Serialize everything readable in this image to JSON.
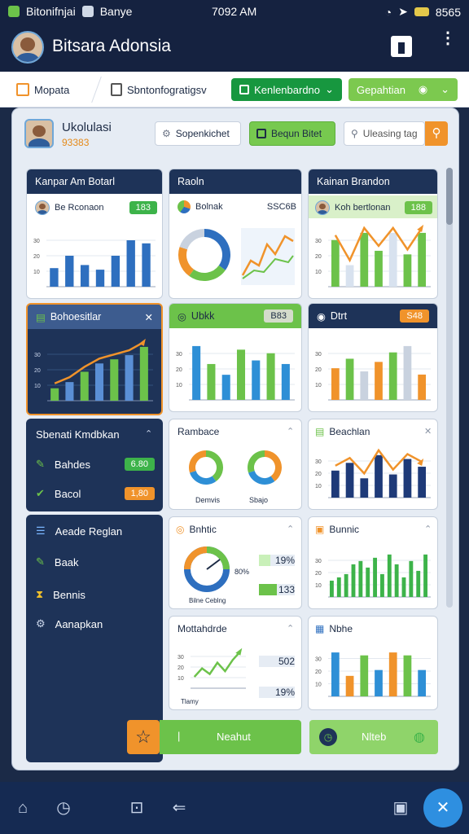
{
  "status": {
    "carrier": "Bitonifnjai",
    "app": "Banye",
    "time": "7092 AM",
    "battery": "8565"
  },
  "header": {
    "title": "Bitsara Adonsia"
  },
  "toolbar": {
    "left_label": "Mopata",
    "middle_label": "Sbntonfogratigsv",
    "green_button": "Kenlenbardno",
    "light_button": "Gepahtian"
  },
  "profile": {
    "name": "Ukolulasi",
    "code": "93383"
  },
  "actions": {
    "chip1": "Sopenkichet",
    "chip2": "Bequn Bitet",
    "search_placeholder": "Uleasing tag"
  },
  "cards": {
    "c1": {
      "title": "Kanpar Am Botarl",
      "sub": "Be Rconaon",
      "badge": "183"
    },
    "c2": {
      "title": "Raoln",
      "sub": "Bolnak",
      "badge": "SSC6B"
    },
    "c3": {
      "title": "Kainan Brandon",
      "sub": "Koh bertlonan",
      "badge": "188"
    },
    "c4": {
      "title": "Bohoesitlar"
    },
    "c5": {
      "title": "Ubkk",
      "badge": "B83"
    },
    "c6": {
      "title": "Dtrt",
      "badge": "S48"
    },
    "c7": {
      "title": "Rambace",
      "label1": "Demvis",
      "label2": "Sbajo"
    },
    "c8": {
      "title": "Beachlan"
    },
    "c9": {
      "title": "Bnhtic",
      "gauge_label": "Bilne Ceblng",
      "gauge_pct": "80%",
      "v1": "19%",
      "v2": "133"
    },
    "c10": {
      "title": "Bunnic"
    },
    "c11": {
      "title": "Mottahdrde",
      "foot": "Tlamy",
      "v1": "502",
      "v2": "19%"
    },
    "c12": {
      "title": "Nbhe"
    }
  },
  "summary": {
    "title": "Sbenati Kmdbkan",
    "row1": "Bahdes",
    "row1_val": "6.80",
    "row2": "Bacol",
    "row2_val": "1,80"
  },
  "nav": {
    "items": [
      "Aeade Reglan",
      "Baak",
      "Bennis",
      "Aanapkan"
    ]
  },
  "footer_buttons": {
    "b1": "Neahut",
    "b2": "Nlteb"
  },
  "colors": {
    "navy": "#1e3358",
    "green": "#6cc24a",
    "orange": "#f0932b",
    "blue": "#2e6fbf"
  },
  "chart_data": [
    {
      "type": "bar",
      "title": "Kanpar Am Botarl",
      "values": [
        12,
        20,
        14,
        11,
        20,
        30,
        28
      ],
      "ylim": [
        0,
        40
      ]
    },
    {
      "type": "pie",
      "title": "Raoln",
      "values": [
        35,
        25,
        20,
        20
      ]
    },
    {
      "type": "bar",
      "title": "Kainan Brandon",
      "values": [
        26,
        12,
        30,
        20,
        30,
        18,
        30
      ]
    },
    {
      "type": "bar",
      "title": "Bohoesitlar",
      "values": [
        6,
        9,
        14,
        18,
        20,
        22,
        26
      ]
    },
    {
      "type": "bar",
      "title": "Ubkk",
      "values": [
        30,
        20,
        14,
        28,
        22,
        26,
        20
      ]
    },
    {
      "type": "bar",
      "title": "Dtrt",
      "values": [
        20,
        26,
        18,
        24,
        30,
        34,
        16
      ]
    },
    {
      "type": "pie",
      "title": "Rambace",
      "values": [
        40,
        30,
        30
      ]
    },
    {
      "type": "bar",
      "title": "Beachlan",
      "values": [
        14,
        18,
        10,
        22,
        12,
        20,
        16
      ]
    },
    {
      "type": "bar",
      "title": "Bunnic",
      "values": [
        10,
        12,
        14,
        20,
        22,
        18,
        24,
        14,
        26,
        20,
        12,
        22,
        16,
        26
      ]
    },
    {
      "type": "line",
      "title": "Mottahdrde",
      "values": [
        8,
        14,
        10,
        18,
        12,
        20,
        26
      ]
    },
    {
      "type": "bar",
      "title": "Nbhe",
      "values": [
        30,
        14,
        28,
        18,
        30,
        28,
        18
      ]
    }
  ]
}
